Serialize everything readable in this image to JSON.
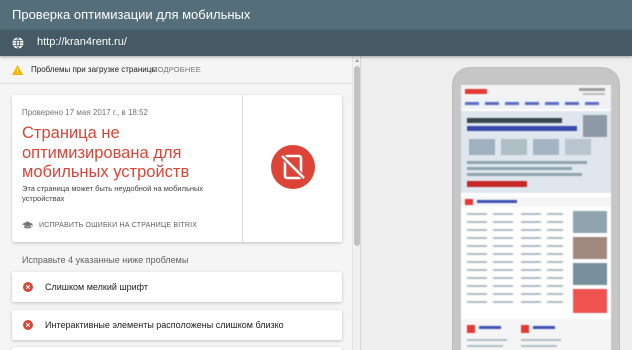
{
  "header": {
    "title": "Проверка оптимизации для мобильных",
    "url": "http://kran4rent.ru/"
  },
  "warning": {
    "text": "Проблемы при загрузке страницы",
    "more_label": "ПОДРОБНЕЕ"
  },
  "result": {
    "checked_date": "Проверено 17 мая 2017 г., в 18:52",
    "headline": "Страница не оптимизирована для мобильных устройств",
    "description": "Эта страница может быть неудобной на мобильных устройствах",
    "fix_link": "ИСПРАВИТЬ ОШИБКИ НА СТРАНИЦЕ BITRIX"
  },
  "issues": {
    "heading": "Исправьте 4 указанные ниже проблемы",
    "items": [
      {
        "label": "Слишком мелкий шрифт"
      },
      {
        "label": "Интерактивные элементы расположены слишком близко"
      }
    ]
  },
  "colors": {
    "header_bg": "#546e7a",
    "url_bar_bg": "#455a64",
    "error_red": "#db4437",
    "warning_yellow": "#f4b400"
  }
}
